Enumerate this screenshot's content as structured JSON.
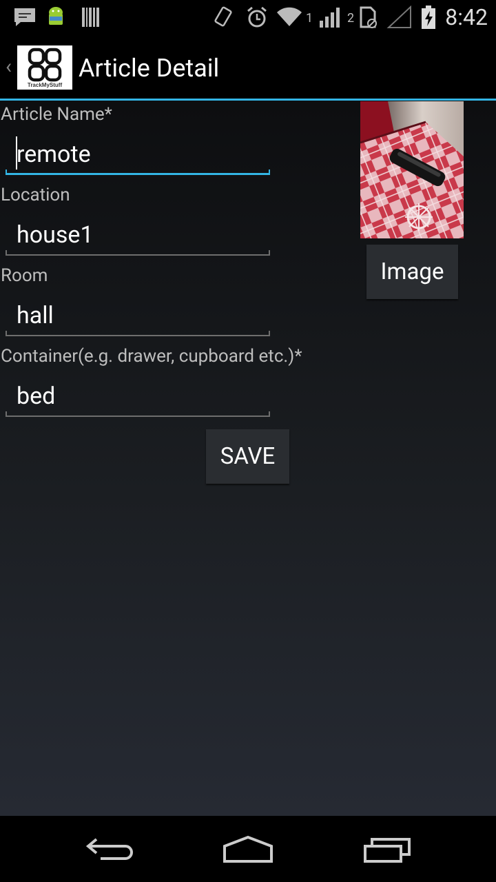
{
  "status_bar": {
    "time": "8:42",
    "sim1": "1",
    "sim2": "2",
    "icons": [
      "sms-icon",
      "android-icon",
      "barcode-icon",
      "vibrate-icon",
      "alarm-icon",
      "wifi-icon",
      "signal-icon",
      "sim-icon",
      "no-signal-icon",
      "battery-icon"
    ]
  },
  "action_bar": {
    "title": "Article Detail",
    "logo_text": "TrackMyStuff"
  },
  "form": {
    "article_name": {
      "label": "Article Name*",
      "value": "remote"
    },
    "location": {
      "label": "Location",
      "value": "house1"
    },
    "room": {
      "label": "Room",
      "value": "hall"
    },
    "container": {
      "label": "Container(e.g. drawer, cupboard etc.)*",
      "value": "bed"
    }
  },
  "buttons": {
    "image": "Image",
    "save": "SAVE"
  },
  "colors": {
    "accent": "#33b5e5",
    "background": "#000000",
    "button_bg": "#2a2d31"
  }
}
